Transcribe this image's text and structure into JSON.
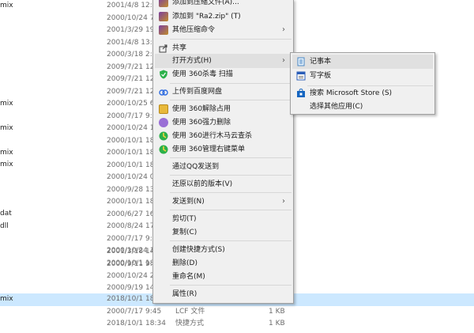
{
  "explorer": {
    "fragments": [
      "mix",
      "mix",
      "mix",
      "mix",
      "mix",
      "dat",
      "dll"
    ],
    "rows": [
      {
        "date": "2001/4/8 12:"
      },
      {
        "date": "2000/10/24 7"
      },
      {
        "date": "2001/3/29 19"
      },
      {
        "date": "2001/4/8 13:"
      },
      {
        "date": "2000/3/18 2:"
      },
      {
        "date": "2009/7/21 12"
      },
      {
        "date": "2009/7/21 12"
      },
      {
        "date": "2009/7/21 12"
      },
      {
        "date": "2000/10/25 6"
      },
      {
        "date": "2000/7/17 9:"
      },
      {
        "date": "2000/10/24 1"
      },
      {
        "date": "2000/10/1 18"
      },
      {
        "date": "2000/10/1 18"
      },
      {
        "date": "2000/10/1 18"
      },
      {
        "date": "2000/10/24 0"
      },
      {
        "date": "2000/9/28 13"
      },
      {
        "date": "2000/10/1 18"
      },
      {
        "date": "2000/6/27 16"
      },
      {
        "date": "2000/8/24 17"
      },
      {
        "date": "2000/7/17 9:"
      },
      {
        "date": "2000/10/24 1"
      },
      {
        "date": "2000/10/1 18"
      },
      {
        "date": "2001/3/18 14"
      },
      {
        "date": "2000/9/11 9:"
      },
      {
        "date": "2000/10/24 2"
      },
      {
        "date": "2000/9/19 14"
      },
      {
        "date": "2018/10/1 18"
      },
      {
        "date": "2000/7/17 9:45",
        "type": "LCF 文件",
        "size": "1 KB"
      },
      {
        "date": "2018/10/1 18:34",
        "type": "快捷方式",
        "size": "1 KB"
      }
    ]
  },
  "context_menu": {
    "items": [
      {
        "label": "添加到压缩文件(A)...",
        "icon": "archive-icon"
      },
      {
        "label": "添加到 \"Ra2.zip\" (T)",
        "icon": "archive-icon"
      },
      {
        "label": "其他压缩命令",
        "icon": "archive-icon",
        "submenu": true
      },
      {
        "label": "共享",
        "icon": "share-icon"
      },
      {
        "label": "打开方式(H)",
        "icon": "",
        "submenu": true,
        "highlighted": true
      },
      {
        "label": "使用 360杀毒 扫描",
        "icon": "shield-360-icon"
      },
      {
        "label": "上传到百度网盘",
        "icon": "baidu-cloud-icon"
      },
      {
        "label": "使用 360解除占用",
        "icon": "folder-360-icon"
      },
      {
        "label": "使用 360强力删除",
        "icon": "delete-360-icon"
      },
      {
        "label": "使用 360进行木马云查杀",
        "icon": "scan-360-icon"
      },
      {
        "label": "使用 360管理右键菜单",
        "icon": "scan-360-icon"
      },
      {
        "label": "通过QQ发送到",
        "icon": ""
      },
      {
        "label": "还原以前的版本(V)",
        "icon": ""
      },
      {
        "label": "发送到(N)",
        "icon": "",
        "submenu": true
      },
      {
        "label": "剪切(T)",
        "icon": ""
      },
      {
        "label": "复制(C)",
        "icon": ""
      },
      {
        "label": "创建快捷方式(S)",
        "icon": ""
      },
      {
        "label": "删除(D)",
        "icon": ""
      },
      {
        "label": "重命名(M)",
        "icon": ""
      },
      {
        "label": "属性(R)",
        "icon": ""
      }
    ]
  },
  "open_with_menu": {
    "items": [
      {
        "label": "记事本",
        "icon": "notepad-icon",
        "highlighted": true
      },
      {
        "label": "写字板",
        "icon": "wordpad-icon"
      },
      {
        "label": "搜索 Microsoft Store (S)",
        "icon": "store-icon"
      },
      {
        "label": "选择其他应用(C)",
        "icon": ""
      }
    ]
  },
  "colors": {
    "menu_bg": "#f0f0f0",
    "highlight": "#e0e0e0",
    "selection": "#cce8ff"
  }
}
